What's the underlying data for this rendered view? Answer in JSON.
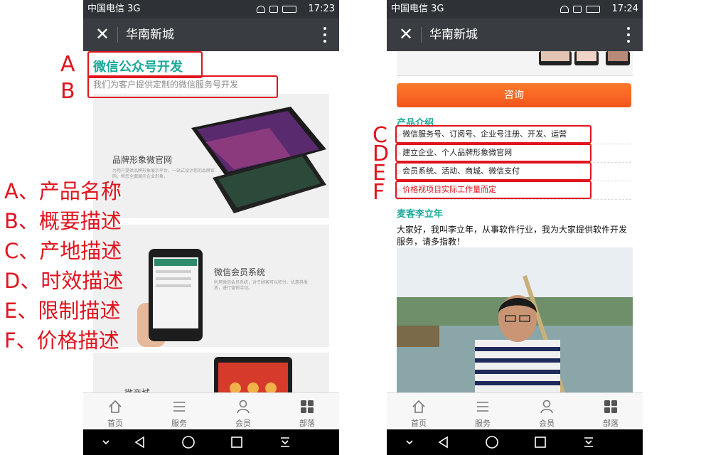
{
  "status_left": {
    "carrier": "中国电信 3G",
    "time": "17:23"
  },
  "status_right": {
    "carrier": "中国电信 3G",
    "time": "17:24"
  },
  "app": {
    "title": "华南新城"
  },
  "left_page": {
    "heading": "微信公众号开发",
    "subheading": "我们为客户提供定制的微信服务号开发",
    "card1_label": "品牌形象微官网",
    "card1_text": "为用户提供品牌形象展示平台，一站式设计您的品牌官网，帮您全面展示企业形象。",
    "card2_label": "微信会员系统",
    "card2_text": "利用微信会员系统，对于顾客可以积分、优惠券发放，进行营销活动。",
    "card3_label": "微商城"
  },
  "right_page": {
    "consult_button": "咨询",
    "product_intro_title": "产品介绍",
    "product_lines": [
      "微信服务号、订阅号、企业号注册、开发、运营",
      "建立企业、个人品牌形象微官网",
      "会员系统、活动、商城、微信支付",
      "价格视项目实际工作量而定"
    ],
    "author_title": "麦客李立年",
    "author_intro": "大家好，我叫李立年，从事软件行业，我为大家提供软件开发服务，请多指教！"
  },
  "tabs": [
    "首页",
    "服务",
    "会员",
    "部落"
  ],
  "annotations": {
    "a": "A",
    "b": "B",
    "c": "C",
    "d": "D",
    "e": "E",
    "f": "F"
  },
  "legend": [
    "A、产品名称",
    "B、概要描述",
    "C、产地描述",
    "D、时效描述",
    "E、限制描述",
    "F、价格描述"
  ],
  "colors": {
    "accent": "#1aa99a",
    "annotation": "#e0141e",
    "button": "#f1551a",
    "titlebar": "#393d41"
  }
}
